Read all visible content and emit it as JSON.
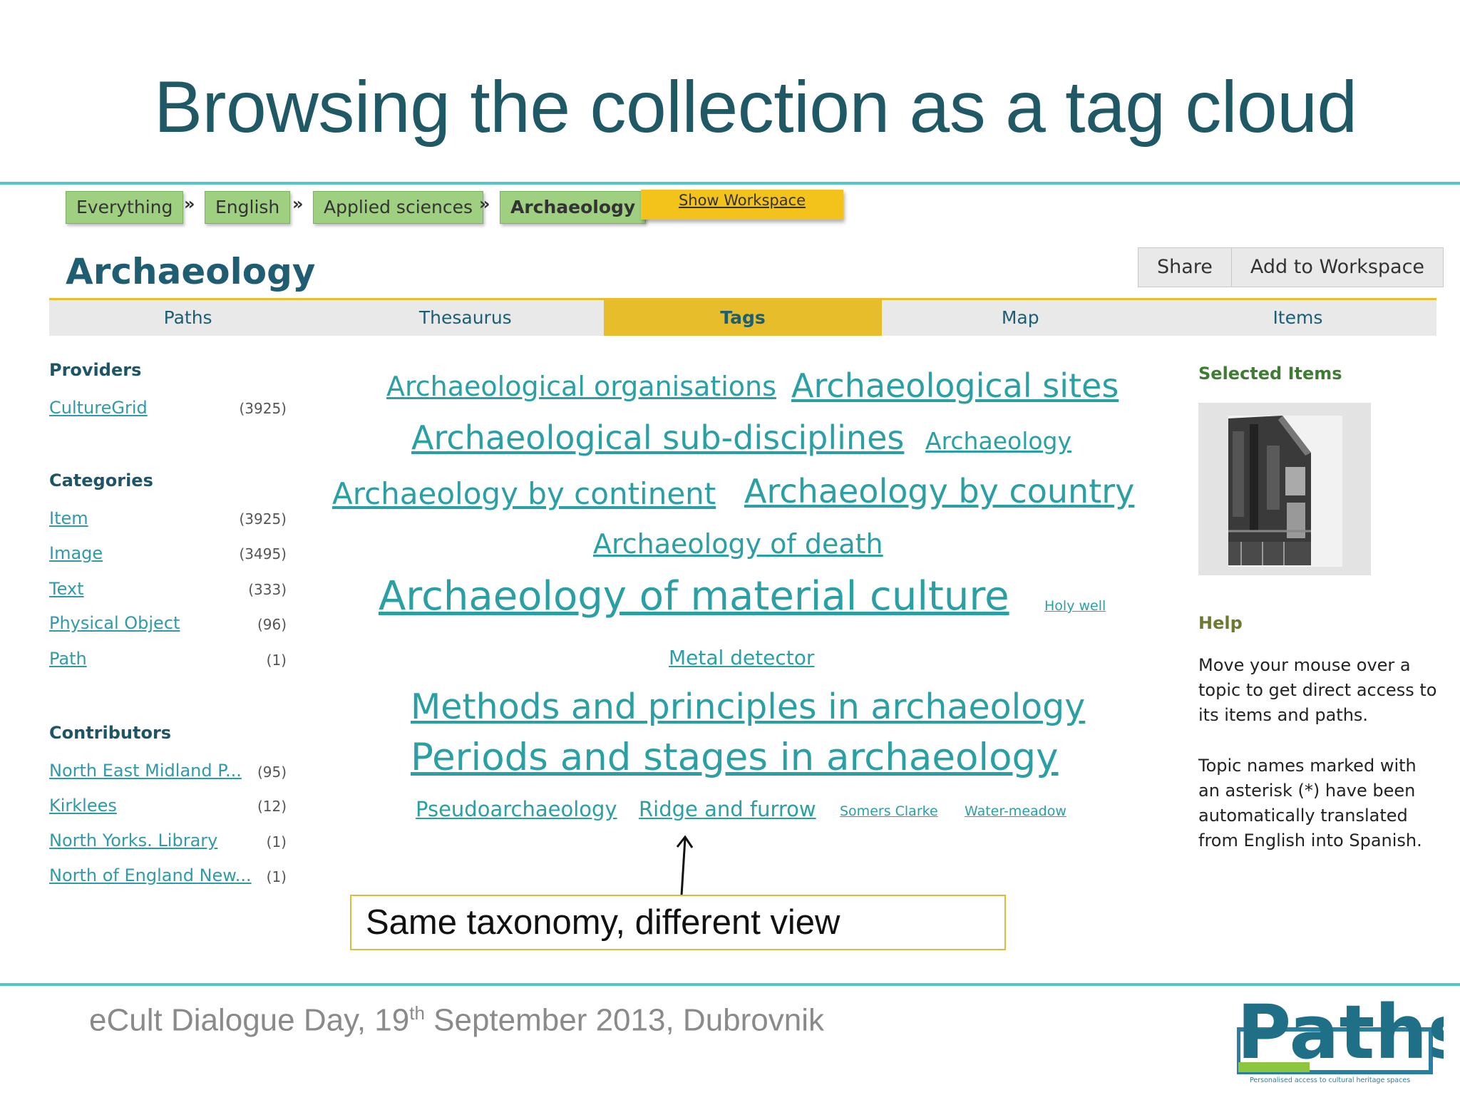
{
  "slide_title": "Browsing the collection as a tag cloud",
  "breadcrumb": [
    "Everything",
    "English",
    "Applied sciences",
    "Archaeology"
  ],
  "breadcrumb_sep": "»",
  "show_workspace": "Show Workspace",
  "page_heading": "Archaeology",
  "actions": {
    "share": "Share",
    "add_workspace": "Add to Workspace"
  },
  "tabs": {
    "paths": "Paths",
    "thesaurus": "Thesaurus",
    "tags": "Tags",
    "map": "Map",
    "items": "Items",
    "active": "Tags"
  },
  "sidebar": {
    "providers_title": "Providers",
    "providers": [
      {
        "label": "CultureGrid",
        "count": "(3925)"
      }
    ],
    "categories_title": "Categories",
    "categories": [
      {
        "label": "Item",
        "count": "(3925)"
      },
      {
        "label": "Image",
        "count": "(3495)"
      },
      {
        "label": "Text",
        "count": "(333)"
      },
      {
        "label": "Physical Object",
        "count": "(96)"
      },
      {
        "label": "Path",
        "count": "(1)"
      }
    ],
    "contributors_title": "Contributors",
    "contributors": [
      {
        "label": "North East Midland P...",
        "count": "(95)"
      },
      {
        "label": "Kirklees",
        "count": "(12)"
      },
      {
        "label": "North Yorks. Library",
        "count": "(1)"
      },
      {
        "label": "North of England New...",
        "count": "(1)"
      }
    ]
  },
  "tags": [
    "Archaeological organisations",
    "Archaeological sites",
    "Archaeological sub-disciplines",
    "Archaeology",
    "Archaeology by continent",
    "Archaeology by country",
    "Archaeology of death",
    "Archaeology of material culture",
    "Holy well",
    "Metal detector",
    "Methods and principles in archaeology",
    "Periods and stages in archaeology",
    "Pseudoarchaeology",
    "Ridge and furrow",
    "Somers Clarke",
    "Water-meadow"
  ],
  "selected_items_title": "Selected Items",
  "help": {
    "title": "Help",
    "lines1": [
      "Move your mouse over a",
      "topic to get direct access to",
      "its items and paths."
    ],
    "lines2": [
      "Topic names marked with",
      "an asterisk (*) have been",
      "automatically translated",
      "from English into Spanish."
    ]
  },
  "callout": "Same taxonomy, different view",
  "footer": {
    "before": "eCult Dialogue Day, 19",
    "sup": "th",
    "after": " September 2013, Dubrovnik"
  },
  "logo": {
    "text": "Paths",
    "tagline": "Personalised access to cultural heritage spaces"
  },
  "colors": {
    "accent_teal": "#52c7c9",
    "tab_active": "#e8bd2b",
    "crumb_green": "#9fd081",
    "tag_link": "#2a9fa4"
  }
}
